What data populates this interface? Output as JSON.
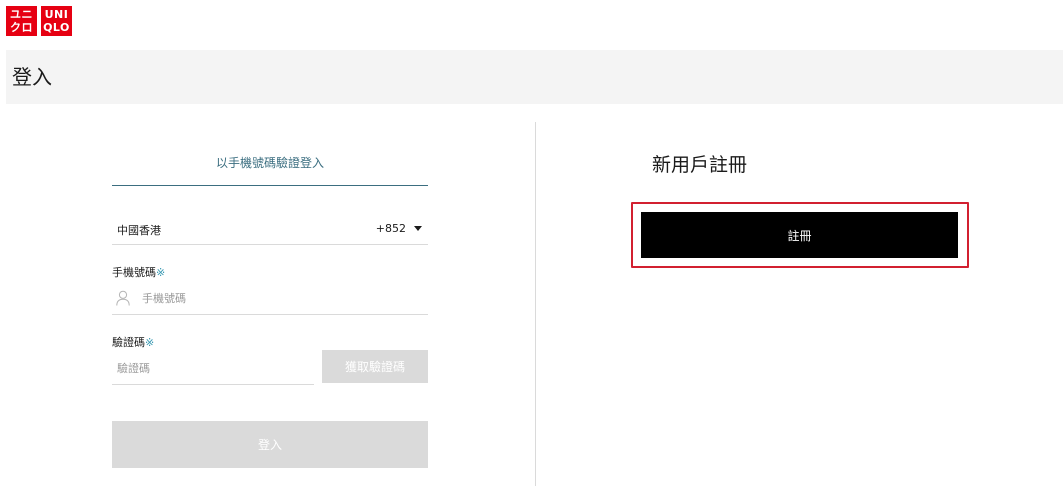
{
  "brand": {
    "logo_katakana": [
      "ユニ",
      "クロ"
    ],
    "logo_latin": [
      "UNI",
      "QLO"
    ],
    "color": "#e60012"
  },
  "page": {
    "title": "登入"
  },
  "login": {
    "tab_label": "以手機號碼驗證登入",
    "country": {
      "name": "中國香港",
      "code": "+852"
    },
    "phone": {
      "label": "手機號碼",
      "required_mark": "※",
      "placeholder": "手機號碼"
    },
    "code": {
      "label": "驗證碼",
      "required_mark": "※",
      "placeholder": "驗證碼",
      "get_code_label": "獲取驗證碼"
    },
    "submit_label": "登入"
  },
  "register": {
    "title": "新用戶註冊",
    "button_label": "註冊",
    "highlight_color": "#d22030"
  },
  "colors": {
    "accent": "#3b6e80",
    "disabled": "#dadada",
    "title_bar": "#f4f4f4"
  }
}
